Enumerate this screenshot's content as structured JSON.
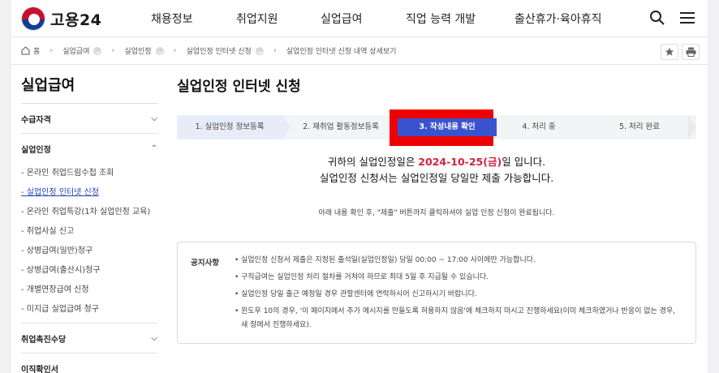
{
  "header": {
    "logo_text": "고용24",
    "nav": [
      "채용정보",
      "취업지원",
      "실업급여",
      "직업 능력 개발",
      "출산휴가·육아휴직"
    ]
  },
  "breadcrumb": [
    "홈",
    "실업급여",
    "실업인정",
    "실업인정 인터넷 신청",
    "실업인정 인터넷 신청 내역 상세보기"
  ],
  "sidebar": {
    "title": "실업급여",
    "groups": [
      {
        "label": "수급자격"
      },
      {
        "label": "실업인정",
        "items": [
          "- 온라인 취업드림수첩 조회",
          "- 실업인정 인터넷 신청",
          "- 온라인 취업특강(1차 실업인정 교육)",
          "- 취업사실 신고",
          "- 상병급여(일반)청구",
          "- 상병급여(출산시)청구",
          "- 개별연장급여 신청",
          "- 미지급 실업급여 청구"
        ]
      },
      {
        "label": "취업촉진수당"
      },
      {
        "label": "이직확인서"
      }
    ]
  },
  "main": {
    "title": "실업인정 인터넷 신청",
    "steps": [
      "1. 실업인정 정보등록",
      "2. 재취업 활동정보등록",
      "3. 작성내용 확인",
      "4. 처리 중",
      "5. 처리 완료"
    ],
    "notice_line1_prefix": "귀하의 실업인정일은 ",
    "notice_date": "2024-10-25(금)",
    "notice_line1_suffix": "일 입니다.",
    "notice_line2": "실업인정 신청서는 실업인정일 당일만 제출 가능합니다.",
    "guide": "아래 내용 확인 후, \"제출\" 버튼까지 클릭하셔야 실업 인정 신청이 완료됩니다.",
    "notice_box": {
      "title": "공지사항",
      "items": [
        "실업인정 신청서 제출은 지정된 출석일(실업인정일) 당일 00:00 ~ 17:00 사이에만 가능합니다.",
        "구직급여는 실업인정 처리 절차를 거쳐야 하므로 최대 5일 후 지급될 수 있습니다.",
        "실업인정 당일 출근 예정일 경우 관할센터에 연락하시어 신고하시기 바랍니다.",
        "윈도우 10의 경우, '이 페이지에서 추가 메시지를 만들도록 허용하지 않음'에 체크하지 마시고 진행하세요(이미 체크하였거나 반응이 없는 경우, 새 창에서 진행하세요)."
      ]
    }
  },
  "colors": {
    "accent": "#3953cf",
    "highlight_frame": "#ee0000",
    "date": "#d4213d"
  }
}
